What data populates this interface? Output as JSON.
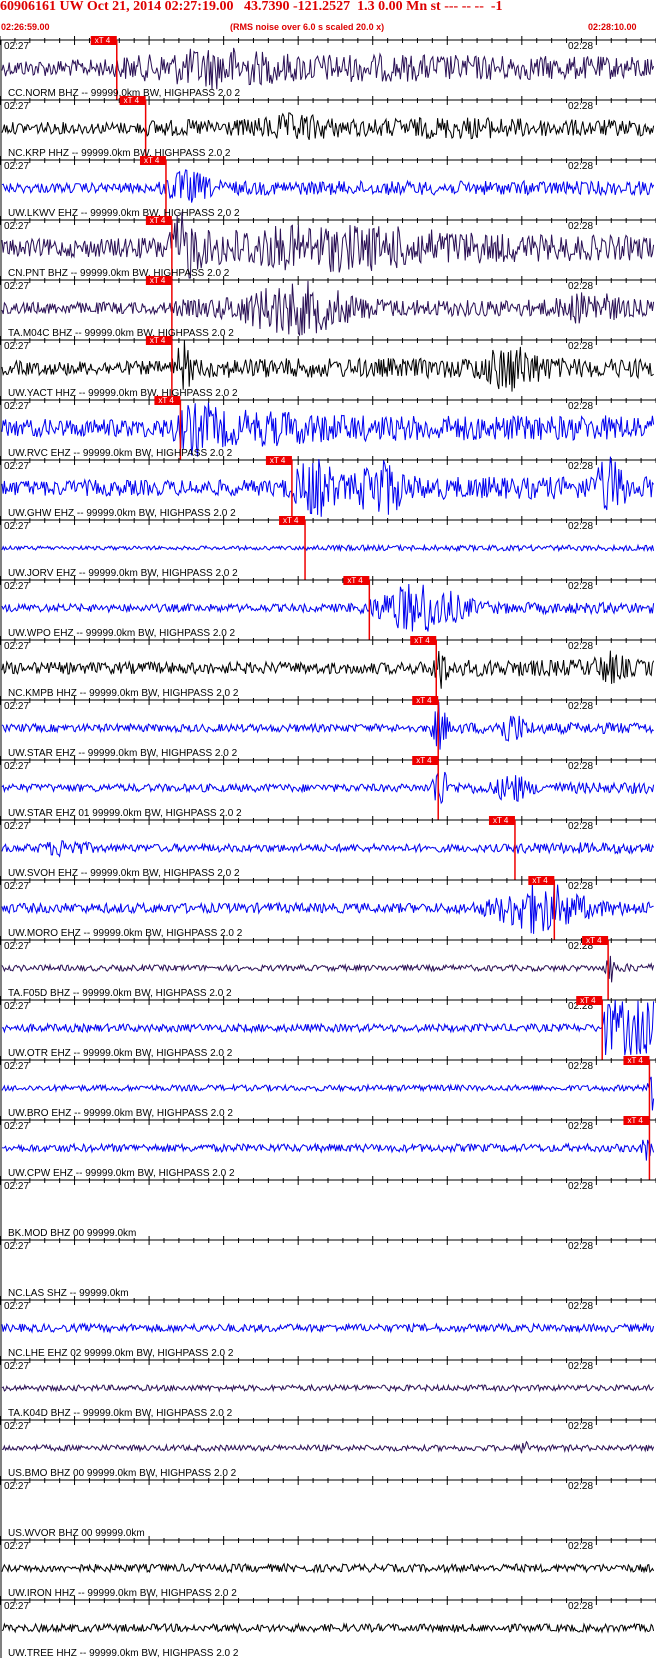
{
  "header": {
    "title": "60906161 UW Oct 21, 2014 02:27:19.00   43.7390 -121.2527  1.3 0.00 Mn st --- -- --  -1",
    "start_time": "02:26:59.00",
    "note": "(RMS noise over 6.0 s scaled 20.0 x)",
    "end_time": "02:28:10.00"
  },
  "time_labels": {
    "left": "02:27",
    "right": "02:28"
  },
  "pick_label": "xT 4",
  "colors": {
    "red": "#ee0000",
    "blue": "#0000ee",
    "black": "#000000",
    "purple": "#2a1055"
  },
  "traces": [
    {
      "label": "CC.NORM BHZ -- 99999.0km BW, HIGHPASS  2.0  2",
      "color": "purple",
      "pick": 0.178,
      "amp": 8,
      "events": [
        [
          0.33,
          0.07,
          9
        ],
        [
          0.5,
          0.3,
          3
        ]
      ]
    },
    {
      "label": "NC.KRP HHZ -- 99999.0km BW, HIGHPASS  2.0  2",
      "color": "black",
      "pick": 0.222,
      "amp": 6,
      "events": [
        [
          0.45,
          0.05,
          7
        ],
        [
          0.7,
          0.1,
          3
        ]
      ]
    },
    {
      "label": "UW.LKWV EHZ -- 99999.0km BW, HIGHPASS  2.0  2",
      "color": "blue",
      "pick": 0.253,
      "amp": 5,
      "events": [
        [
          0.285,
          0.03,
          12
        ]
      ]
    },
    {
      "label": "CN.PNT BHZ -- 99999.0km BW, HIGHPASS  2.0  2",
      "color": "purple",
      "pick": 0.262,
      "amp": 9,
      "events": [
        [
          0.28,
          0.02,
          22
        ],
        [
          0.5,
          0.2,
          12
        ]
      ]
    },
    {
      "label": "TA.M04C BHZ -- 99999.0km BW, HIGHPASS  2.0  2",
      "color": "purple",
      "pick": 0.262,
      "amp": 6,
      "events": [
        [
          0.45,
          0.08,
          20
        ],
        [
          0.9,
          0.04,
          10
        ]
      ]
    },
    {
      "label": "UW.YACT HHZ -- 99999.0km BW, HIGHPASS  2.0  2",
      "color": "black",
      "pick": 0.262,
      "amp": 7,
      "events": [
        [
          0.28,
          0.01,
          20
        ],
        [
          0.78,
          0.04,
          16
        ]
      ]
    },
    {
      "label": "UW.RVC EHZ -- 99999.0km BW, HIGHPASS  2.0  2",
      "color": "blue",
      "pick": 0.275,
      "amp": 9,
      "events": [
        [
          0.3,
          0.03,
          14
        ],
        [
          0.4,
          0.1,
          6
        ]
      ]
    },
    {
      "label": "UW.GHW EHZ -- 99999.0km BW, HIGHPASS  2.0  2",
      "color": "blue",
      "pick": 0.445,
      "amp": 8,
      "events": [
        [
          0.48,
          0.03,
          20
        ],
        [
          0.58,
          0.03,
          22
        ],
        [
          0.93,
          0.02,
          22
        ]
      ]
    },
    {
      "label": "UW.JORV EHZ -- 99999.0km BW, HIGHPASS  2.0  2",
      "color": "blue",
      "pick": 0.465,
      "amp": 2,
      "events": []
    },
    {
      "label": "UW.WPO EHZ -- 99999.0km BW, HIGHPASS  2.0  2",
      "color": "blue",
      "pick": 0.563,
      "amp": 4,
      "events": [
        [
          0.64,
          0.06,
          22
        ]
      ]
    },
    {
      "label": "NC.KMPB HHZ -- 99999.0km BW, HIGHPASS  2.0  2",
      "color": "black",
      "pick": 0.665,
      "amp": 6,
      "events": [
        [
          0.67,
          0.01,
          16
        ],
        [
          0.93,
          0.02,
          10
        ]
      ]
    },
    {
      "label": "UW.STAR EHZ -- 99999.0km BW, HIGHPASS  2.0  2",
      "color": "blue",
      "pick": 0.668,
      "amp": 4,
      "events": [
        [
          0.67,
          0.01,
          22
        ],
        [
          0.78,
          0.02,
          12
        ]
      ]
    },
    {
      "label": "UW.STAR EHZ 01 99999.0km BW, HIGHPASS  2.0  2",
      "color": "blue",
      "pick": 0.668,
      "amp": 4,
      "events": [
        [
          0.67,
          0.01,
          22
        ],
        [
          0.78,
          0.02,
          12
        ]
      ]
    },
    {
      "label": "UW.SVOH EHZ -- 99999.0km BW, HIGHPASS  2.0  2",
      "color": "blue",
      "pick": 0.785,
      "amp": 4,
      "events": [
        [
          0.1,
          0.03,
          6
        ]
      ]
    },
    {
      "label": "UW.MORO EHZ -- 99999.0km BW, HIGHPASS  2.0  2",
      "color": "blue",
      "pick": 0.845,
      "amp": 5,
      "events": [
        [
          0.82,
          0.06,
          22
        ]
      ]
    },
    {
      "label": "TA.F05D BHZ -- 99999.0km BW, HIGHPASS  2.0  2",
      "color": "purple",
      "pick": 0.927,
      "amp": 3,
      "events": [
        [
          0.93,
          0.005,
          18
        ]
      ]
    },
    {
      "label": "UW.OTR EHZ -- 99999.0km BW, HIGHPASS  2.0  2",
      "color": "blue",
      "pick": 0.918,
      "amp": 4,
      "events": [],
      "clip": 0.918
    },
    {
      "label": "UW.BRO EHZ -- 99999.0km BW, HIGHPASS  2.0  2",
      "color": "blue",
      "pick": 0.99,
      "amp": 3,
      "events": [
        [
          0.995,
          0.005,
          20
        ]
      ]
    },
    {
      "label": "UW.CPW EHZ -- 99999.0km BW, HIGHPASS  2.0  2",
      "color": "blue",
      "pick": 0.99,
      "amp": 4,
      "events": [
        [
          0.985,
          0.005,
          12
        ]
      ]
    },
    {
      "label": "BK.MOD BHZ 00 99999.0km",
      "color": "none",
      "pick": null,
      "amp": 0,
      "events": []
    },
    {
      "label": "NC.LAS SHZ -- 99999.0km",
      "color": "none",
      "pick": null,
      "amp": 0,
      "events": []
    },
    {
      "label": "NC.LHE EHZ 02 99999.0km BW, HIGHPASS  2.0  2",
      "color": "blue",
      "pick": null,
      "amp": 4,
      "events": []
    },
    {
      "label": "TA.K04D BHZ -- 99999.0km BW, HIGHPASS  2.0  2",
      "color": "purple",
      "pick": null,
      "amp": 3,
      "events": []
    },
    {
      "label": "US.BMO BHZ 00 99999.0km BW, HIGHPASS  2.0  2",
      "color": "purple",
      "pick": null,
      "amp": 3,
      "events": [
        [
          0.8,
          0.005,
          10
        ]
      ]
    },
    {
      "label": "US.WVOR BHZ 00 99999.0km",
      "color": "none",
      "pick": null,
      "amp": 0,
      "events": []
    },
    {
      "label": "UW.IRON HHZ -- 99999.0km BW, HIGHPASS  2.0  2",
      "color": "black",
      "pick": null,
      "amp": 4,
      "events": []
    },
    {
      "label": "UW.TREE HHZ -- 99999.0km BW, HIGHPASS  2.0  2",
      "color": "black",
      "pick": null,
      "amp": 4,
      "events": []
    }
  ]
}
